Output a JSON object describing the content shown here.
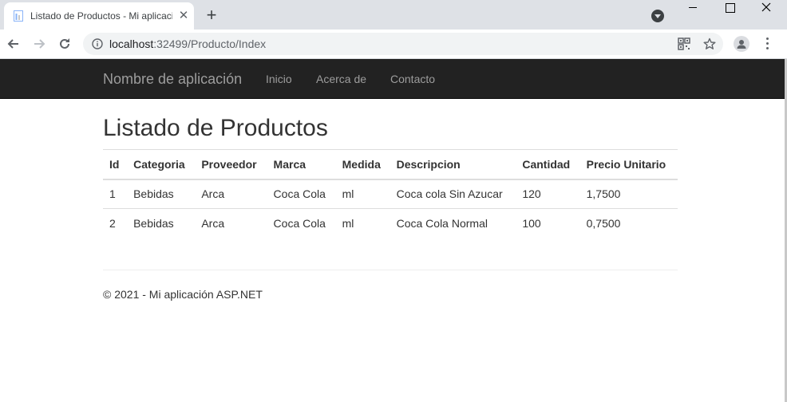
{
  "browser": {
    "tab_title": "Listado de Productos - Mi aplicación ASP.NET",
    "url_host": "localhost",
    "url_path": ":32499/Producto/Index"
  },
  "navbar": {
    "brand": "Nombre de aplicación",
    "links": [
      "Inicio",
      "Acerca de",
      "Contacto"
    ]
  },
  "main": {
    "title": "Listado de Productos",
    "table": {
      "headers": [
        "Id",
        "Categoria",
        "Proveedor",
        "Marca",
        "Medida",
        "Descripcion",
        "Cantidad",
        "Precio Unitario"
      ],
      "rows": [
        [
          "1",
          "Bebidas",
          "Arca",
          "Coca Cola",
          "ml",
          "Coca cola Sin Azucar",
          "120",
          "1,7500"
        ],
        [
          "2",
          "Bebidas",
          "Arca",
          "Coca Cola",
          "ml",
          "Coca Cola Normal",
          "100",
          "0,7500"
        ]
      ]
    }
  },
  "footer": {
    "text": "© 2021 - Mi aplicación ASP.NET"
  },
  "icons": {
    "back": "arrow-left-icon",
    "forward": "arrow-right-icon",
    "reload": "reload-icon",
    "info": "info-icon",
    "qr": "qr-code-icon",
    "bookmark": "star-icon",
    "profile": "person-icon",
    "menu": "kebab-menu-icon"
  },
  "colors": {
    "navbar_bg": "#222222",
    "navbar_text": "#9d9d9d",
    "body_text": "#333333",
    "table_border": "#dddddd",
    "chrome_tabstrip": "#dee1e6"
  }
}
